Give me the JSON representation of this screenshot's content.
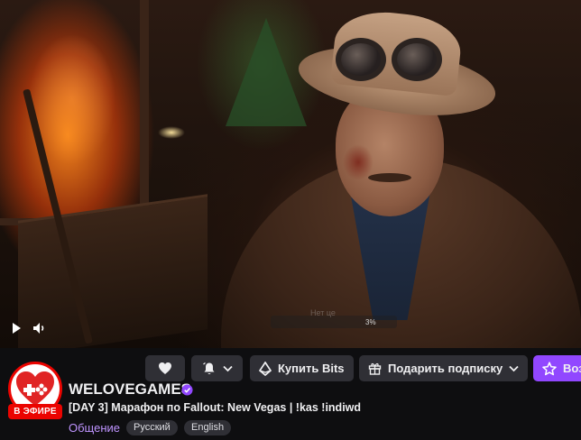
{
  "player": {
    "overlay_text": "Нет це",
    "overlay_percent": "3%",
    "progress": 0.03
  },
  "channel": {
    "name": "WELOVEGAMES",
    "live_label": "В ЭФИРЕ",
    "verified": true,
    "stream_title": "[DAY 3] Марафон по Fallout: New Vegas | !kas !indiwd",
    "category": "Общение",
    "tags": [
      "Русский",
      "English"
    ]
  },
  "actions": {
    "bits_label": "Купить Bits",
    "gift_label": "Подарить подписку",
    "subscribe_label": "Воз"
  },
  "icons": {
    "play": "play-icon",
    "volume": "volume-icon",
    "follow": "heart-icon",
    "notify": "bell-icon",
    "bits": "bits-gem-icon",
    "gift": "gift-icon",
    "subscribe": "star-icon",
    "verified": "verified-badge-icon"
  },
  "colors": {
    "background": "#0e0e10",
    "button": "#2f2f35",
    "accent": "#9147ff",
    "category": "#bf94ff",
    "live": "#eb0400"
  }
}
